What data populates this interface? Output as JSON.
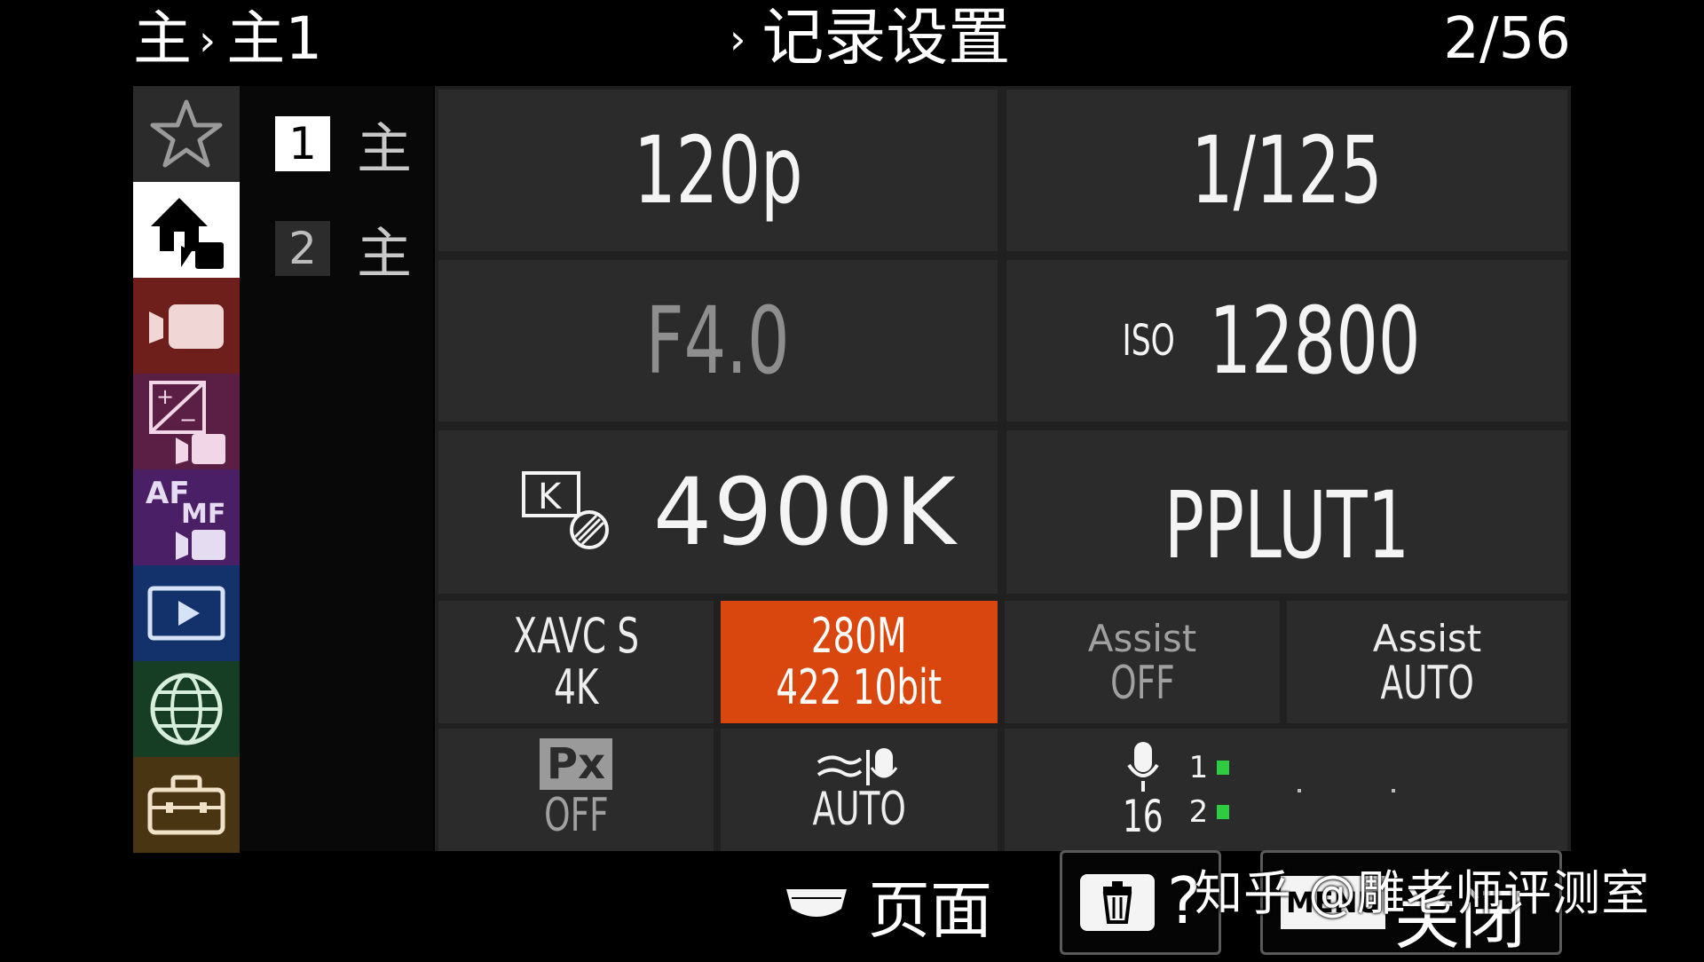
{
  "header": {
    "breadcrumb_root": "主",
    "breadcrumb_sub": "主1",
    "section_title": "记录设置",
    "page_counter": "2/56"
  },
  "categories": [
    {
      "icon": "star-icon",
      "color": "#2b2b2b"
    },
    {
      "icon": "home-movie-icon",
      "color": "#ffffff",
      "selected": true
    },
    {
      "icon": "movie-camera-icon",
      "color": "#6e1f1c"
    },
    {
      "icon": "exposure-movie-icon",
      "color": "#5b1f45"
    },
    {
      "icon": "af-mf-movie-icon",
      "color": "#4a1f66"
    },
    {
      "icon": "playback-icon",
      "color": "#13316a"
    },
    {
      "icon": "globe-icon",
      "color": "#163e25"
    },
    {
      "icon": "toolbox-icon",
      "color": "#4a3512"
    }
  ],
  "af_icon_text": {
    "af": "AF",
    "mf": "MF"
  },
  "subtabs": [
    {
      "number": "1",
      "label": "主",
      "active": true
    },
    {
      "number": "2",
      "label": "主",
      "active": false
    }
  ],
  "params": {
    "frame_rate": "120p",
    "shutter": "1/125",
    "aperture": "F4.0",
    "iso_label": "ISO",
    "iso_value": "12800",
    "wb_icon_letter": "K",
    "white_balance": "4900K",
    "picture_profile": "PPLUT1"
  },
  "rec_settings": {
    "format_line1": "XAVC S",
    "format_line2": "4K",
    "bitrate_line1": "280M",
    "bitrate_line2": "422 10bit",
    "assist1_line1": "Assist",
    "assist1_line2": "OFF",
    "assist2_line1": "Assist",
    "assist2_line2": "AUTO",
    "px_label": "Px",
    "px_value": "OFF",
    "wind_value": "AUTO",
    "audio_level": "16",
    "audio_ch1": "1",
    "audio_ch2": "2"
  },
  "colors": {
    "selected_cell": "#d9470f",
    "audio_meter": "#2ecc40"
  },
  "footer": {
    "page_label": "页面",
    "help_label": "?",
    "menu_label": "MENU",
    "close_label": "关闭"
  },
  "watermark": "知乎 @雕老师评测室"
}
